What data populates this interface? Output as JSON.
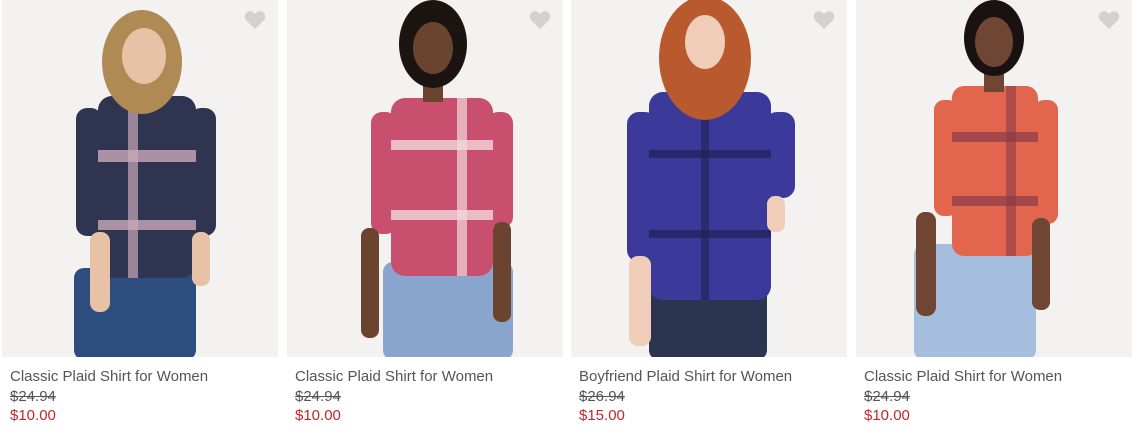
{
  "products": [
    {
      "name": "Classic Plaid Shirt for Women",
      "original_price": "$24.94",
      "sale_price": "$10.00",
      "shirt_color": "#2f3550",
      "shirt_accent": "#c9a9b8",
      "hair_color": "#b08a55",
      "skin_color": "#e8c2a6",
      "pants_color": "#2c4d7d",
      "favorite_icon": "heart-icon"
    },
    {
      "name": "Classic Plaid Shirt for Women",
      "original_price": "$24.94",
      "sale_price": "$10.00",
      "shirt_color": "#c8506e",
      "shirt_accent": "#f1d7df",
      "hair_color": "#1c1410",
      "skin_color": "#6b4430",
      "pants_color": "#8aa6cf",
      "favorite_icon": "heart-icon"
    },
    {
      "name": "Boyfriend Plaid Shirt for Women",
      "original_price": "$26.94",
      "sale_price": "$15.00",
      "shirt_color": "#3b3a9a",
      "shirt_accent": "#1f1f55",
      "hair_color": "#b85a2e",
      "skin_color": "#f0cdb8",
      "pants_color": "#2b3550",
      "favorite_icon": "heart-icon"
    },
    {
      "name": "Classic Plaid Shirt for Women",
      "original_price": "$24.94",
      "sale_price": "$10.00",
      "shirt_color": "#e2664e",
      "shirt_accent": "#8a3b4a",
      "hair_color": "#1a1210",
      "skin_color": "#6f4533",
      "pants_color": "#a5bedd",
      "favorite_icon": "heart-icon"
    }
  ],
  "colors": {
    "sale_price": "#c0272d",
    "text": "#555555",
    "heart": "#d2d2d2"
  }
}
